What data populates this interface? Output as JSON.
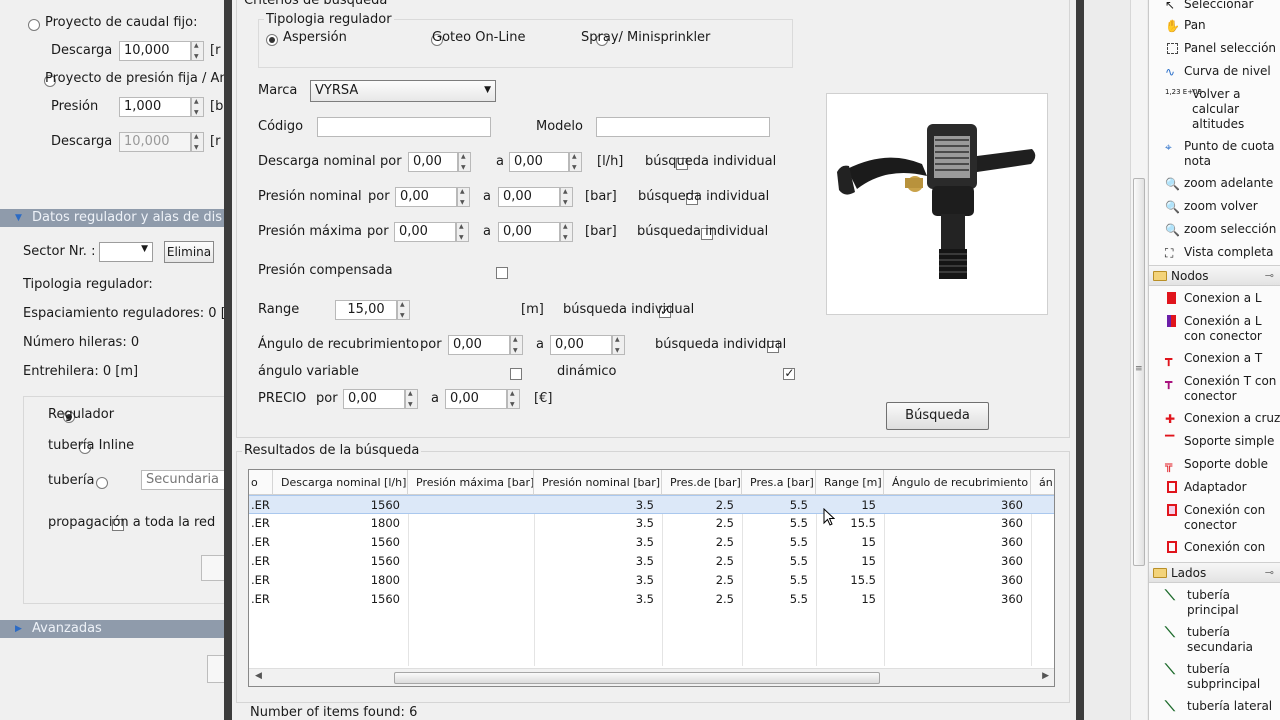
{
  "left_panel": {
    "caudal_fijo_label": "Proyecto de caudal fijo:",
    "descarga_label": "Descarga",
    "descarga_value": "10,000",
    "unit_partial": "[r",
    "presion_fija_label": "Proyecto de presión fija / An",
    "presion_label": "Presión",
    "presion_value": "1,000",
    "presion_unit_partial": "[b",
    "descarga2_label": "Descarga",
    "descarga2_value": "10,000",
    "section_datos": "Datos regulador y alas de dis",
    "sector_label": "Sector Nr. :",
    "elimina_button": "Elimina",
    "tipologia_label": "Tipologia regulador:",
    "espaciamiento_label": "Espaciamiento reguladores: 0 [",
    "hileras_label": "Número hileras: 0",
    "entrehilera_label": "Entrehilera: 0 [m]",
    "radio_regulador": "Regulador",
    "radio_inline": "tubería Inline",
    "radio_tuberia": "tubería",
    "tuberia_select": "Secundaria",
    "propagacion_label": "propagación a toda la red",
    "section_avanzadas": "Avanzadas"
  },
  "dialog": {
    "group_title": "Criterios de búsqueda",
    "tipologia_title": "Tipologia regulador",
    "tipologia_options": [
      "Aspersión",
      "Goteo On-Line",
      "Spray/ Minisprinkler"
    ],
    "marca_label": "Marca",
    "marca_value": "VYRSA",
    "codigo_label": "Código",
    "modelo_label": "Modelo",
    "descarga_nominal_label": "Descarga nominal",
    "presion_nominal_label": "Presión nominal",
    "presion_maxima_label": "Presión máxima",
    "por": "por",
    "a": "a",
    "zero": "0,00",
    "unit_lh": "[l/h]",
    "unit_bar": "[bar]",
    "unit_m": "[m]",
    "unit_eur": "[€]",
    "busqueda_individual": "búsqueda individual",
    "presion_compensada_label": "Presión compensada",
    "range_label": "Range",
    "range_value": "15,00",
    "angulo_label": "Ángulo de recubrimiento",
    "angulo_variable_label": "ángulo variable",
    "dinamico_label": "dinámico",
    "precio_label": "PRECIO",
    "busqueda_button": "Búsqueda",
    "resultados_title": "Resultados de la búsqueda",
    "items_found": "Number of items found: 6"
  },
  "table": {
    "columns": [
      "o",
      "Descarga nominal [l/h]",
      "Presión máxima [bar]",
      "Presión nominal [bar]",
      "Pres.de [bar]",
      "Pres.a [bar]",
      "Range [m]",
      "Ángulo de recubrimiento",
      "án"
    ],
    "rows": [
      [
        ".ER",
        "1560",
        "",
        "3.5",
        "2.5",
        "5.5",
        "15",
        "360"
      ],
      [
        ".ER",
        "1800",
        "",
        "3.5",
        "2.5",
        "5.5",
        "15.5",
        "360"
      ],
      [
        ".ER",
        "1560",
        "",
        "3.5",
        "2.5",
        "5.5",
        "15",
        "360"
      ],
      [
        ".ER",
        "1560",
        "",
        "3.5",
        "2.5",
        "5.5",
        "15",
        "360"
      ],
      [
        ".ER",
        "1800",
        "",
        "3.5",
        "2.5",
        "5.5",
        "15.5",
        "360"
      ],
      [
        ".ER",
        "1560",
        "",
        "3.5",
        "2.5",
        "5.5",
        "15",
        "360"
      ]
    ]
  },
  "right_panel": {
    "tools": [
      "Seleccionar",
      "Pan",
      "Panel selección",
      "Curva de nivel",
      "Volver a calcular altitudes",
      "Punto de cuota nota",
      "zoom adelante",
      "zoom volver",
      "zoom selección",
      "Vista completa"
    ],
    "exp_icon_text": "1,23 E+03",
    "nodos_header": "Nodos",
    "nodos": [
      "Conexion a L",
      "Conexión a L con conector",
      "Conexion a T",
      "Conexión T con conector",
      "Conexion a cruz",
      "Soporte simple",
      "Soporte doble",
      "Adaptador",
      "Conexión con conector",
      "Conexión con"
    ],
    "lados_header": "Lados",
    "lados": [
      "tubería principal",
      "tubería secundaria",
      "tubería subprincipal",
      "tubería lateral"
    ]
  }
}
